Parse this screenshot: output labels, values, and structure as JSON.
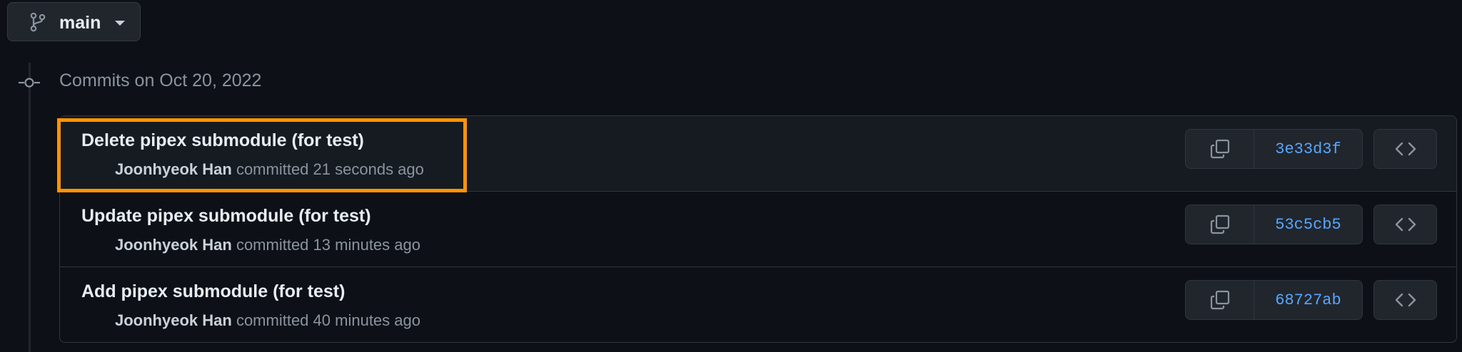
{
  "branch": {
    "name": "main",
    "icon": "git-branch-icon"
  },
  "timeline": {
    "heading": "Commits on Oct 20, 2022",
    "icon": "git-commit-icon"
  },
  "commits": [
    {
      "title": "Delete pipex submodule (for test)",
      "author": "Joonhyeok Han",
      "action": "committed",
      "time": "21 seconds ago",
      "sha": "3e33d3f"
    },
    {
      "title": "Update pipex submodule (for test)",
      "author": "Joonhyeok Han",
      "action": "committed",
      "time": "13 minutes ago",
      "sha": "53c5cb5"
    },
    {
      "title": "Add pipex submodule (for test)",
      "author": "Joonhyeok Han",
      "action": "committed",
      "time": "40 minutes ago",
      "sha": "68727ab"
    }
  ],
  "colors": {
    "background": "#0d1117",
    "link": "#58a6ff",
    "highlight": "#ff9500"
  }
}
